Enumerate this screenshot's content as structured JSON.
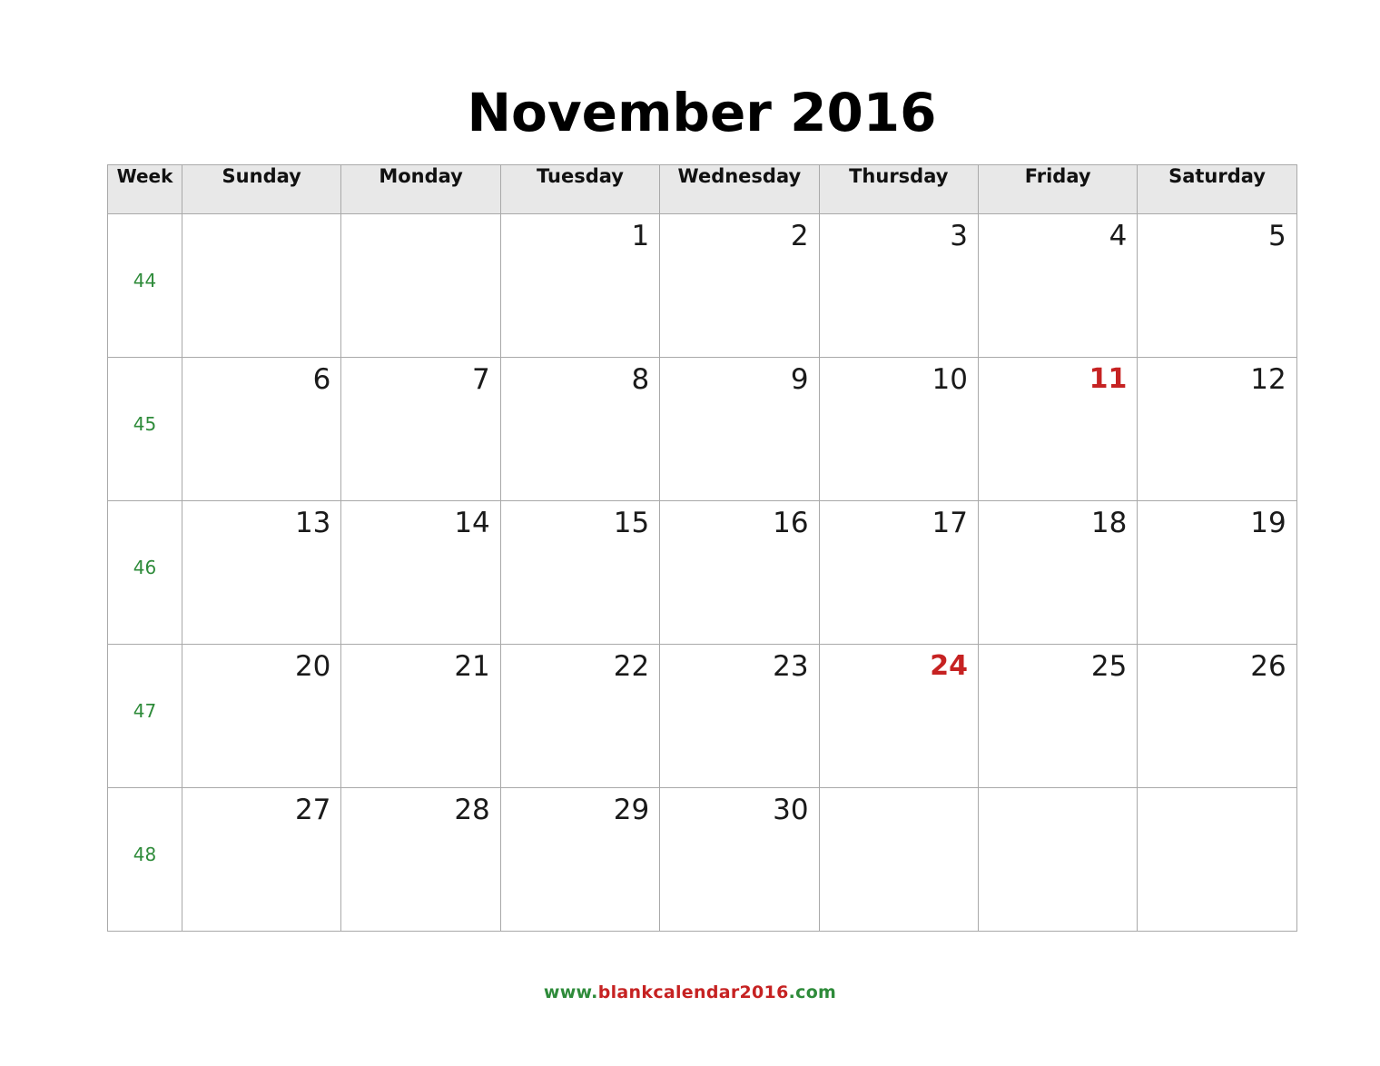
{
  "title": "November 2016",
  "colors": {
    "week_number": "#2e8b3a",
    "holiday": "#c62222",
    "header_background": "#e8e8e8",
    "grid_line": "#a9a9a9",
    "day_number": "#1a1a1a"
  },
  "header": {
    "week_label": "Week",
    "days": [
      "Sunday",
      "Monday",
      "Tuesday",
      "Wednesday",
      "Thursday",
      "Friday",
      "Saturday"
    ]
  },
  "weeks": [
    {
      "week_number": "44",
      "days": [
        {
          "date": "",
          "holiday": false
        },
        {
          "date": "",
          "holiday": false
        },
        {
          "date": "1",
          "holiday": false
        },
        {
          "date": "2",
          "holiday": false
        },
        {
          "date": "3",
          "holiday": false
        },
        {
          "date": "4",
          "holiday": false
        },
        {
          "date": "5",
          "holiday": false
        }
      ]
    },
    {
      "week_number": "45",
      "days": [
        {
          "date": "6",
          "holiday": false
        },
        {
          "date": "7",
          "holiday": false
        },
        {
          "date": "8",
          "holiday": false
        },
        {
          "date": "9",
          "holiday": false
        },
        {
          "date": "10",
          "holiday": false
        },
        {
          "date": "11",
          "holiday": true
        },
        {
          "date": "12",
          "holiday": false
        }
      ]
    },
    {
      "week_number": "46",
      "days": [
        {
          "date": "13",
          "holiday": false
        },
        {
          "date": "14",
          "holiday": false
        },
        {
          "date": "15",
          "holiday": false
        },
        {
          "date": "16",
          "holiday": false
        },
        {
          "date": "17",
          "holiday": false
        },
        {
          "date": "18",
          "holiday": false
        },
        {
          "date": "19",
          "holiday": false
        }
      ]
    },
    {
      "week_number": "47",
      "days": [
        {
          "date": "20",
          "holiday": false
        },
        {
          "date": "21",
          "holiday": false
        },
        {
          "date": "22",
          "holiday": false
        },
        {
          "date": "23",
          "holiday": false
        },
        {
          "date": "24",
          "holiday": true
        },
        {
          "date": "25",
          "holiday": false
        },
        {
          "date": "26",
          "holiday": false
        }
      ]
    },
    {
      "week_number": "48",
      "days": [
        {
          "date": "27",
          "holiday": false
        },
        {
          "date": "28",
          "holiday": false
        },
        {
          "date": "29",
          "holiday": false
        },
        {
          "date": "30",
          "holiday": false
        },
        {
          "date": "",
          "holiday": false
        },
        {
          "date": "",
          "holiday": false
        },
        {
          "date": "",
          "holiday": false
        }
      ]
    }
  ],
  "footer": {
    "parts": [
      {
        "text": "www.",
        "color": "green"
      },
      {
        "text": "blankcalendar2016",
        "color": "red"
      },
      {
        "text": ".com",
        "color": "green"
      }
    ],
    "full_text": "www.blankcalendar2016.com"
  }
}
